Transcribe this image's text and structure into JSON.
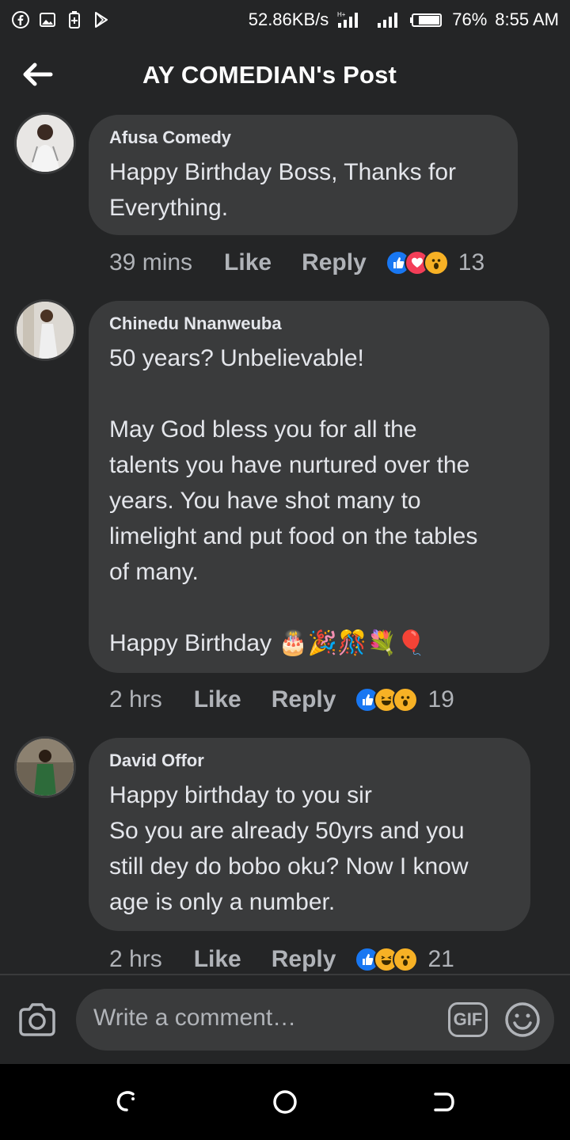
{
  "status": {
    "speed": "52.86KB/s",
    "battery": "76%",
    "time": "8:55 AM"
  },
  "header": {
    "title": "AY COMEDIAN's Post"
  },
  "comments": [
    {
      "author": "Afusa Comedy",
      "text": "Happy Birthday Boss, Thanks for Everything.",
      "time": "39 mins",
      "like": "Like",
      "reply": "Reply",
      "reactions": [
        "like",
        "love",
        "wow"
      ],
      "count": "13"
    },
    {
      "author": "Chinedu Nnanweuba",
      "text_lines": [
        "50 years? Unbelievable!",
        "",
        "May God bless you for all the",
        "talents you have nurtured over the",
        "years. You have shot many to",
        "limelight and put food on the tables",
        "of many.",
        "",
        "Happy Birthday"
      ],
      "emojis": "🎂🎉🎊💐🎈",
      "time": "2 hrs",
      "like": "Like",
      "reply": "Reply",
      "reactions": [
        "like",
        "haha",
        "wow"
      ],
      "count": "19"
    },
    {
      "author": "David Offor",
      "text_lines": [
        "Happy birthday to you sir",
        "So you are already 50yrs and you",
        "still dey do bobo oku? Now I know",
        "age is only a number."
      ],
      "time": "2 hrs",
      "like": "Like",
      "reply": "Reply",
      "reactions": [
        "like",
        "haha",
        "wow"
      ],
      "count": "21"
    }
  ],
  "composer": {
    "placeholder": "Write a comment…",
    "gif_label": "GIF"
  }
}
